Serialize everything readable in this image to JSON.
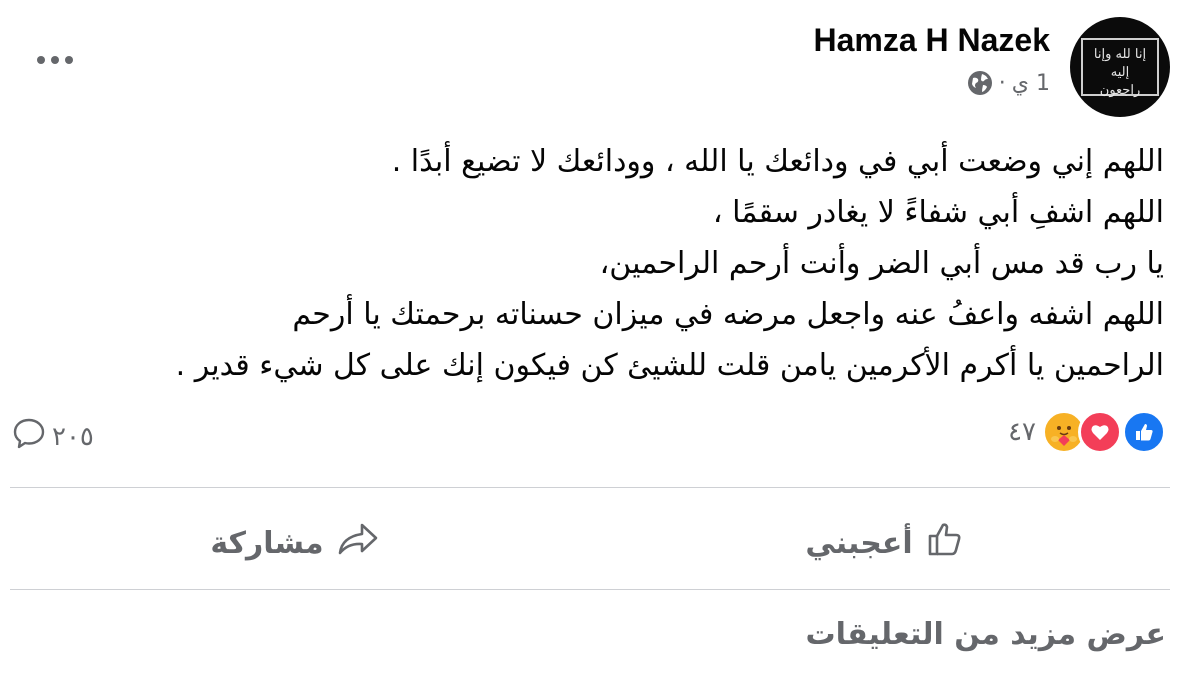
{
  "post": {
    "author": "Hamza H Nazek",
    "time": "1 ي",
    "separator": "·",
    "avatar_text": [
      "إنا لله وإنا إليه",
      "راجعون"
    ],
    "lines": [
      "اللهم إني وضعت أبي في ودائعك يا الله ، وودائعك لا تضيع أبدًا .",
      "اللهم اشفِ أبي شفاءً لا يغادر سقمًا ،",
      "يا رب قد مس أبي الضر وأنت أرحم الراحمين،",
      "اللهم اشفه واعفُ عنه واجعل مرضه في ميزان حسناته برحمتك يا أرحم",
      "الراحمين يا أكرم الأكرمين يامن قلت للشيئ كن فيكون إنك على كل شيء قدير ."
    ]
  },
  "stats": {
    "reactions_count": "٤٧",
    "comments_count": "٢٠٥",
    "reaction_icons": [
      "like-icon",
      "love-icon",
      "care-icon"
    ]
  },
  "actions": {
    "like_label": "أعجبني",
    "share_label": "مشاركة"
  },
  "footer": {
    "more_comments": "عرض مزيد من التعليقات"
  },
  "colors": {
    "like_blue": "#1877f2",
    "love_red": "#f33e58",
    "care_yellow": "#f7b125",
    "secondary_text": "#65676b",
    "divider": "#ced0d4"
  }
}
